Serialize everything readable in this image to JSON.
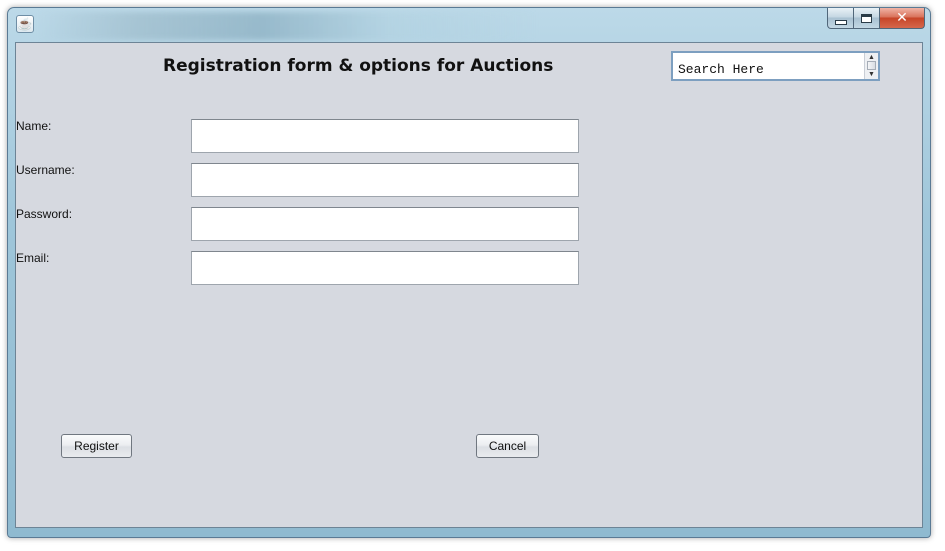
{
  "window": {
    "app_icon": "java-cup-icon",
    "caption_buttons": {
      "minimize_icon": "minimize-icon",
      "maximize_icon": "maximize-icon",
      "close_icon": "close-icon",
      "close_glyph": "✕"
    }
  },
  "form": {
    "title": "Registration form & options for Auctions",
    "search": {
      "placeholder": "Search Here",
      "value": ""
    },
    "fields": {
      "name": {
        "label": "Name:",
        "value": ""
      },
      "username": {
        "label": "Username:",
        "value": ""
      },
      "password": {
        "label": "Password:",
        "value": ""
      },
      "email": {
        "label": "Email:",
        "value": ""
      }
    },
    "buttons": {
      "register": "Register",
      "cancel": "Cancel"
    }
  },
  "colors": {
    "content_background": "#d6d9e0",
    "frame_accent": "#9fc6da",
    "close_button": "#c74528"
  }
}
